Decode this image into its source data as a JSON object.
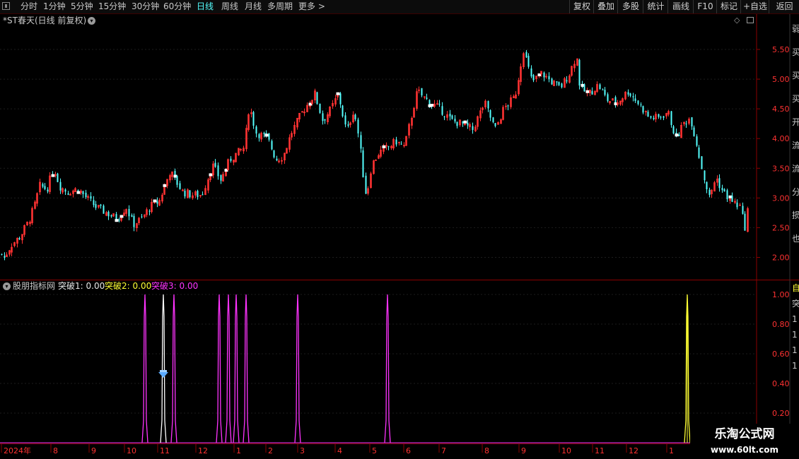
{
  "toolbar": {
    "periods": [
      "分时",
      "1分钟",
      "5分钟",
      "15分钟",
      "30分钟",
      "60分钟",
      "日线",
      "周线",
      "月线",
      "多周期",
      "更多 >"
    ],
    "active_period": "日线",
    "right_buttons": [
      "复权",
      "叠加",
      "多股",
      "统计",
      "画线",
      "F10",
      "标记",
      "+自选",
      "返回"
    ]
  },
  "main": {
    "title": "*ST春天(日线 前复权)",
    "y_ticks": [
      "5.50",
      "5.00",
      "4.50",
      "4.00",
      "3.50",
      "3.00",
      "2.50",
      "2.00"
    ],
    "right_edge_text": [
      "弱",
      "买",
      "买",
      "买",
      "开",
      "流",
      "流",
      "分",
      "损",
      "也"
    ]
  },
  "indicator": {
    "name": "股朋指标网",
    "items": [
      {
        "label": "突破1:",
        "value": "0.00",
        "color": "#e6e6e6"
      },
      {
        "label": "突破2:",
        "value": "0.00",
        "color": "#ffff33"
      },
      {
        "label": "突破3:",
        "value": "0.00",
        "color": "#ff33ff"
      }
    ],
    "y_ticks": [
      "1.00",
      "0.80",
      "0.60",
      "0.40",
      "0.20"
    ],
    "right_edge_text": [
      "自",
      "突",
      "1",
      "1",
      "1",
      "1"
    ]
  },
  "xaxis": {
    "labels": [
      "2024年",
      "8",
      "9",
      "10",
      "11",
      "12",
      "1",
      "2",
      "3",
      "4",
      "5",
      "6",
      "7",
      "8",
      "9",
      "10",
      "11",
      "12",
      "1"
    ]
  },
  "watermark": {
    "line1": "乐淘公式网",
    "line2": "www.60lt.com"
  },
  "colors": {
    "up": "#ff3232",
    "down": "#54ffff",
    "frame": "#8b0000",
    "active": "#54ffff",
    "line1": "#ffffff",
    "line2": "#ffff33",
    "line3": "#ff33ff",
    "marker": "#5aaaff"
  },
  "chart_data": {
    "type": "candlestick",
    "price_range": [
      1.75,
      5.85
    ],
    "indicator_range": [
      0,
      1.05
    ],
    "close_path": [
      [
        0,
        2.1
      ],
      [
        5,
        1.98
      ],
      [
        15,
        2.2
      ],
      [
        28,
        2.35
      ],
      [
        40,
        2.6
      ],
      [
        48,
        2.85
      ],
      [
        56,
        3.2
      ],
      [
        66,
        3.15
      ],
      [
        76,
        3.5
      ],
      [
        84,
        3.2
      ],
      [
        95,
        3.1
      ],
      [
        110,
        3.15
      ],
      [
        122,
        3.0
      ],
      [
        135,
        2.85
      ],
      [
        150,
        2.75
      ],
      [
        165,
        2.65
      ],
      [
        178,
        2.85
      ],
      [
        188,
        2.55
      ],
      [
        200,
        2.65
      ],
      [
        212,
        2.85
      ],
      [
        225,
        2.95
      ],
      [
        240,
        3.45
      ],
      [
        258,
        3.1
      ],
      [
        272,
        3.05
      ],
      [
        285,
        3.05
      ],
      [
        300,
        3.55
      ],
      [
        312,
        3.3
      ],
      [
        325,
        3.65
      ],
      [
        345,
        3.85
      ],
      [
        352,
        4.55
      ],
      [
        362,
        4.1
      ],
      [
        378,
        4.0
      ],
      [
        390,
        3.65
      ],
      [
        400,
        3.7
      ],
      [
        412,
        4.1
      ],
      [
        425,
        4.4
      ],
      [
        436,
        4.6
      ],
      [
        445,
        4.75
      ],
      [
        456,
        4.3
      ],
      [
        468,
        4.5
      ],
      [
        478,
        4.75
      ],
      [
        490,
        4.1
      ],
      [
        500,
        4.5
      ],
      [
        508,
        3.95
      ],
      [
        512,
        3.5
      ],
      [
        518,
        3.0
      ],
      [
        525,
        3.55
      ],
      [
        535,
        3.75
      ],
      [
        548,
        3.85
      ],
      [
        560,
        3.95
      ],
      [
        572,
        3.85
      ],
      [
        580,
        4.3
      ],
      [
        590,
        4.8
      ],
      [
        598,
        4.7
      ],
      [
        608,
        4.6
      ],
      [
        622,
        4.5
      ],
      [
        638,
        4.3
      ],
      [
        652,
        4.25
      ],
      [
        668,
        4.15
      ],
      [
        685,
        4.6
      ],
      [
        700,
        4.15
      ],
      [
        712,
        4.5
      ],
      [
        728,
        4.7
      ],
      [
        740,
        5.5
      ],
      [
        752,
        4.95
      ],
      [
        766,
        5.1
      ],
      [
        780,
        4.95
      ],
      [
        792,
        4.85
      ],
      [
        805,
        5.1
      ],
      [
        815,
        5.4
      ],
      [
        820,
        4.85
      ],
      [
        832,
        4.75
      ],
      [
        846,
        4.9
      ],
      [
        858,
        4.65
      ],
      [
        872,
        4.6
      ],
      [
        888,
        4.8
      ],
      [
        902,
        4.6
      ],
      [
        918,
        4.35
      ],
      [
        932,
        4.35
      ],
      [
        944,
        4.45
      ],
      [
        956,
        4.0
      ],
      [
        966,
        4.25
      ],
      [
        976,
        4.35
      ],
      [
        986,
        3.85
      ],
      [
        993,
        3.45
      ],
      [
        1003,
        3.0
      ],
      [
        1012,
        3.35
      ],
      [
        1022,
        3.1
      ],
      [
        1034,
        2.95
      ],
      [
        1046,
        2.85
      ],
      [
        1053,
        2.5
      ],
      [
        1060,
        3.05
      ]
    ],
    "indicator_spikes": [
      {
        "series": "突破3",
        "x": 205,
        "value": 1.0
      },
      {
        "series": "突破1",
        "x": 231,
        "value": 1.0
      },
      {
        "series": "突破3",
        "x": 246,
        "value": 1.0
      },
      {
        "series": "突破3",
        "x": 310,
        "value": 1.0
      },
      {
        "series": "突破3",
        "x": 323,
        "value": 1.0
      },
      {
        "series": "突破3",
        "x": 334,
        "value": 1.0
      },
      {
        "series": "突破3",
        "x": 348,
        "value": 1.0
      },
      {
        "series": "突破3",
        "x": 421,
        "value": 1.0
      },
      {
        "series": "突破3",
        "x": 548,
        "value": 1.0
      },
      {
        "series": "突破2",
        "x": 972,
        "value": 1.0
      }
    ]
  }
}
